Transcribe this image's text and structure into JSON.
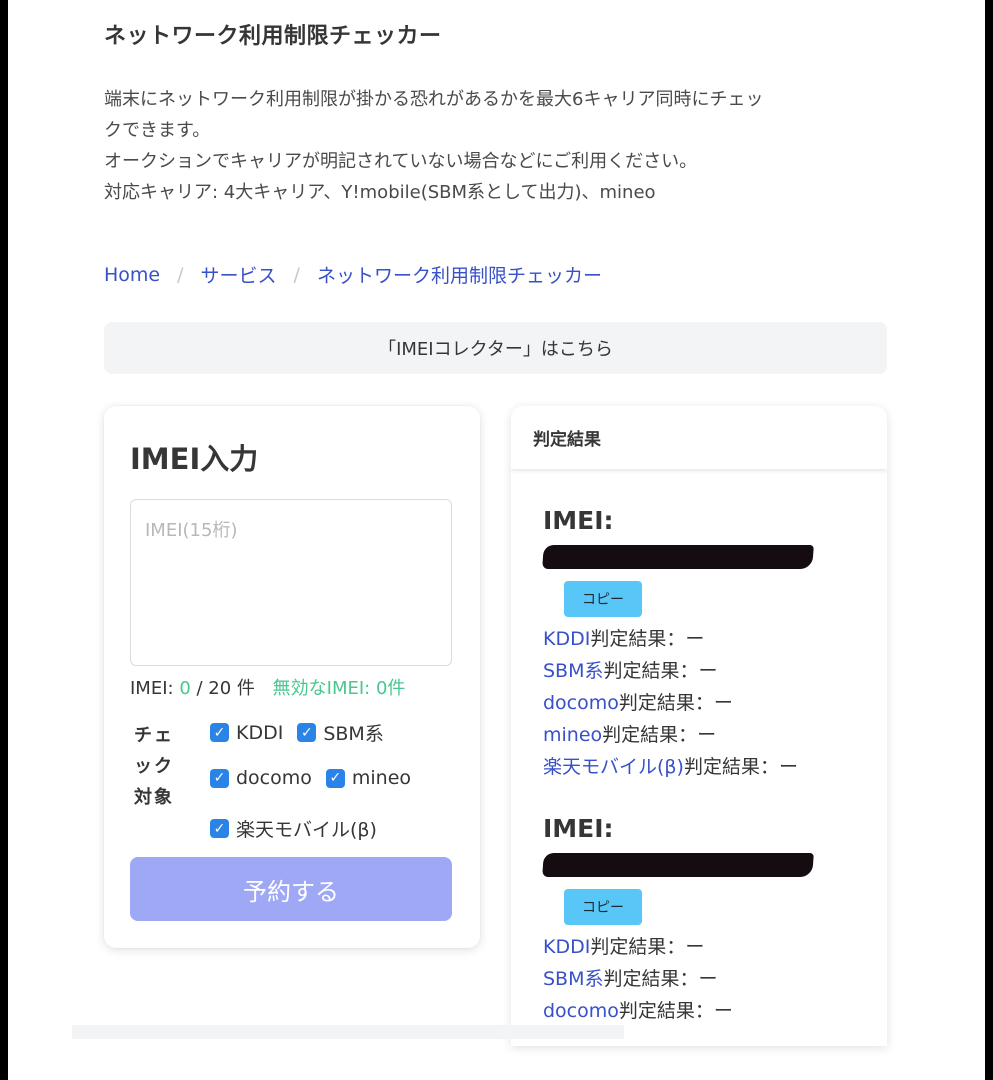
{
  "page": {
    "title": "ネットワーク利用制限チェッカー",
    "description": [
      "端末にネットワーク利用制限が掛かる恐れがあるかを最大6キャリア同時にチェッ",
      "クできます。",
      "オークションでキャリアが明記されていない場合などにご利用ください。",
      "対応キャリア: 4大キャリア、Y!mobile(SBM系として出力)、mineo"
    ]
  },
  "breadcrumb": {
    "items": [
      "Home",
      "サービス",
      "ネットワーク利用制限チェッカー"
    ],
    "separator": "/"
  },
  "collector_link": "「IMEIコレクター」はこちら",
  "input_card": {
    "title": "IMEI入力",
    "placeholder": "IMEI(15桁)",
    "value": "",
    "counter_prefix": "IMEI: ",
    "counter_count": "0",
    "counter_suffix": " / 20 件",
    "invalid_text": "無効なIMEI: 0件",
    "check_label": "チェック対象",
    "checkboxes": [
      {
        "label": "KDDI",
        "checked": true
      },
      {
        "label": "SBM系",
        "checked": true
      },
      {
        "label": "docomo",
        "checked": true
      },
      {
        "label": "mineo",
        "checked": true
      },
      {
        "label": "楽天モバイル(β)",
        "checked": true
      }
    ],
    "submit_label": "予約する"
  },
  "result_card": {
    "header": "判定結果",
    "entries": [
      {
        "heading": "IMEI:",
        "copy_label": "コピー",
        "results": [
          {
            "carrier": "KDDI",
            "label": "判定結果：ー"
          },
          {
            "carrier": "SBM系",
            "label": "判定結果：ー"
          },
          {
            "carrier": "docomo",
            "label": "判定結果：ー"
          },
          {
            "carrier": "mineo",
            "label": "判定結果：ー"
          },
          {
            "carrier": "楽天モバイル(β)",
            "label": "判定結果：ー"
          }
        ]
      },
      {
        "heading": "IMEI:",
        "copy_label": "コピー",
        "results": [
          {
            "carrier": "KDDI",
            "label": "判定結果：ー"
          },
          {
            "carrier": "SBM系",
            "label": "判定結果：ー"
          },
          {
            "carrier": "docomo",
            "label": "判定結果：ー"
          }
        ]
      }
    ]
  },
  "colors": {
    "link": "#3850c8",
    "checkbox": "#2a84e8",
    "valid_count": "#48c78e",
    "submit_disabled": "#9fa8f5",
    "copy_button": "#58c6f6"
  }
}
